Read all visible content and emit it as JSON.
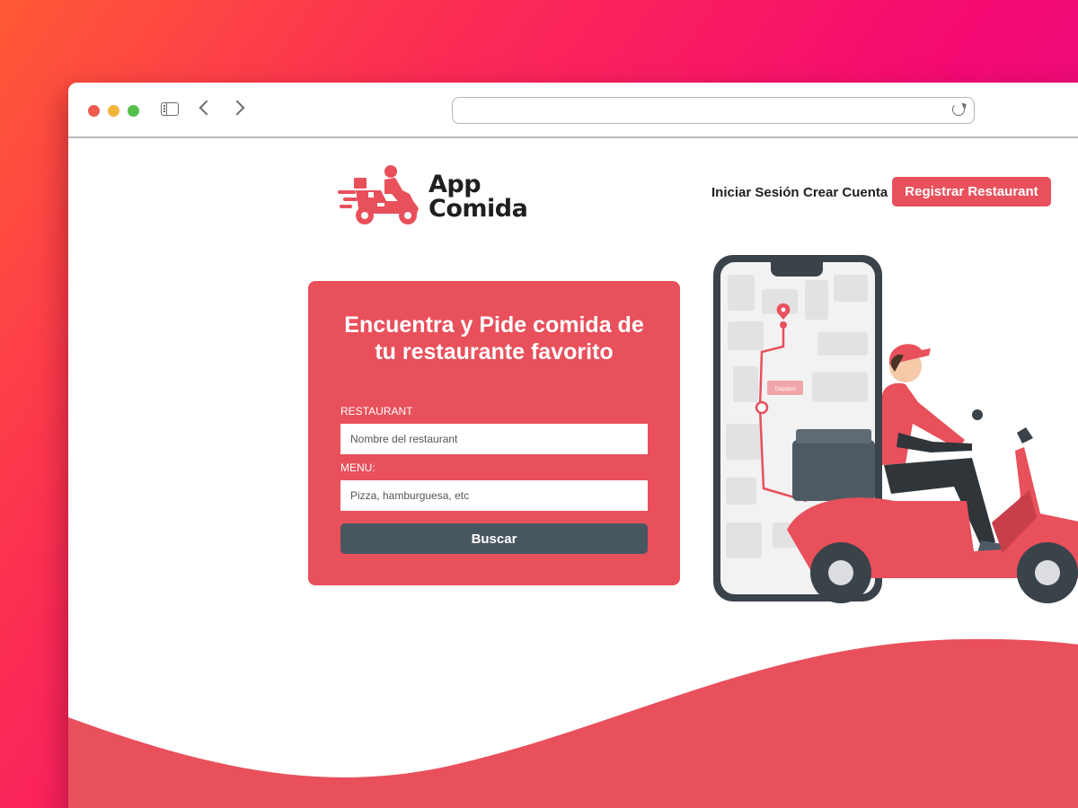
{
  "browser": {
    "url": ""
  },
  "header": {
    "logo_line1": "App",
    "logo_line2": "Comida",
    "nav_login": "Iniciar Sesión",
    "nav_create_account": "Crear Cuenta",
    "register_button": "Registrar Restaurant"
  },
  "search_card": {
    "title_line1": "Encuentra y Pide comida de",
    "title_line2": "tu restaurante favorito",
    "restaurant_label": "RESTAURANT",
    "restaurant_placeholder": "Nombre del restaurant",
    "menu_label": "MENU:",
    "menu_placeholder": "Pizza, hamburguesa, etc",
    "search_button": "Buscar"
  },
  "illustration": {
    "map_tag": "Dispatch"
  },
  "colors": {
    "brand_red": "#e8505b",
    "button_dark": "#485660",
    "text_dark": "#1f1f1f"
  },
  "icons": [
    "sidebar-icon",
    "chevron-left-icon",
    "chevron-right-icon",
    "reload-icon",
    "delivery-scooter-logo-icon"
  ]
}
